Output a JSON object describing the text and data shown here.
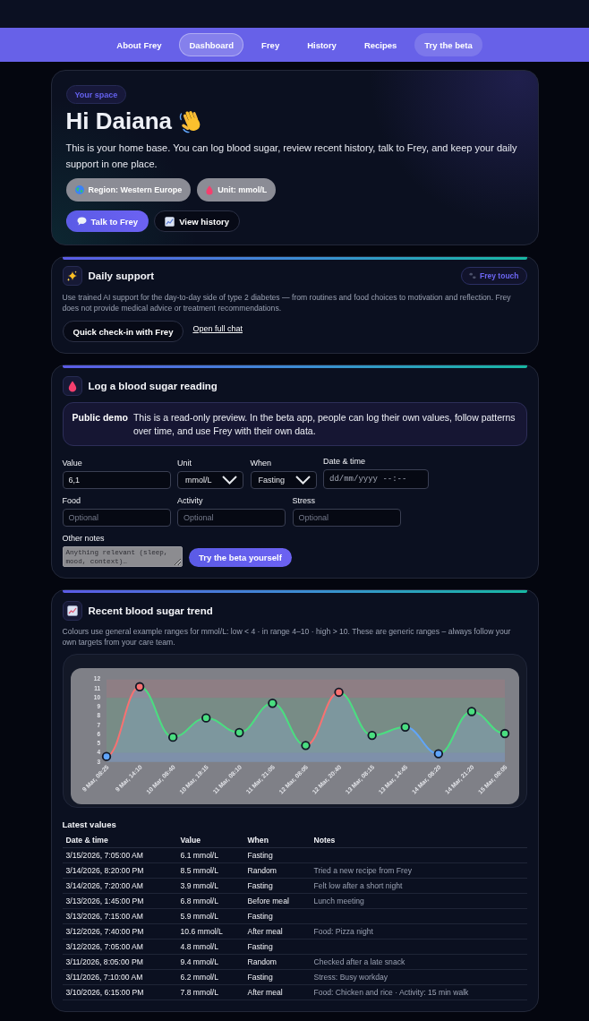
{
  "nav": {
    "items": [
      {
        "label": "About Frey",
        "selected": false,
        "kind": "link"
      },
      {
        "label": "Dashboard",
        "selected": true,
        "kind": "link"
      },
      {
        "label": "Frey",
        "selected": false,
        "kind": "link"
      },
      {
        "label": "History",
        "selected": false,
        "kind": "link"
      },
      {
        "label": "Recipes",
        "selected": false,
        "kind": "link"
      },
      {
        "label": "Try the beta",
        "selected": false,
        "kind": "cta"
      }
    ]
  },
  "hero": {
    "badge": "Your space",
    "title": "Hi Daiana",
    "text": "This is your home base. You can log blood sugar, review recent history, talk to Frey, and keep your daily support in one place.",
    "chips": [
      {
        "kind": "region",
        "label": "Region: Western Europe"
      },
      {
        "kind": "unit",
        "label": "Unit: mmol/L"
      }
    ],
    "actions": [
      {
        "kind": "primary",
        "label": "Talk to Frey"
      },
      {
        "kind": "secondary",
        "label": "View history"
      }
    ]
  },
  "daily_support": {
    "title": "Daily support",
    "badge": "Frey touch",
    "text": "Use trained AI support for the day-to-day side of type 2 diabetes — from routines and food choices to motivation and reflection. Frey does not provide medical advice or treatment recommendations.",
    "button": "Quick check-in with Frey",
    "link": "Open full chat"
  },
  "log_reading": {
    "title": "Log a blood sugar reading",
    "notice": {
      "label": "Public demo",
      "text": "This is a read-only preview. In the beta app, people can log their own values, follow patterns over time, and use Frey with their own data."
    },
    "field_rows": [
      {
        "fields": [
          {
            "kind": "input",
            "label": "Value",
            "value": "6,1"
          },
          {
            "kind": "select",
            "label": "Unit",
            "value": "mmol/L"
          },
          {
            "kind": "select",
            "label": "When",
            "value": "Fasting"
          },
          {
            "kind": "datetime",
            "label": "Date & time",
            "placeholder": "dd/mm/yyyy --:--"
          }
        ]
      },
      {
        "fields": [
          {
            "kind": "input",
            "label": "Food",
            "placeholder": "Optional"
          },
          {
            "kind": "input",
            "label": "Activity",
            "placeholder": "Optional"
          },
          {
            "kind": "input",
            "label": "Stress",
            "placeholder": "Optional"
          }
        ]
      }
    ],
    "notes": {
      "label": "Other notes",
      "placeholder": "Anything relevant (sleep, mood, context)…",
      "disabled": true
    },
    "button": "Try the beta yourself"
  },
  "trend": {
    "title": "Recent blood sugar trend",
    "text": "Colours use general example ranges for mmol/L: low < 4 · in range 4–10 · high > 10. These are generic ranges – always follow your own targets from your care team.",
    "chart_data": {
      "type": "area",
      "marker": true,
      "categories": [
        "9 Mar, 08:25",
        "9 Mar, 14:10",
        "10 Mar, 08:40",
        "10 Mar, 19:15",
        "11 Mar, 08:10",
        "11 Mar, 21:05",
        "12 Mar, 08:05",
        "12 Mar, 20:40",
        "13 Mar, 08:15",
        "13 Mar, 14:45",
        "14 Mar, 08:20",
        "14 Mar, 21:20",
        "15 Mar, 08:05"
      ],
      "values": [
        3.6,
        11.2,
        5.7,
        7.8,
        6.2,
        9.4,
        4.8,
        10.6,
        5.9,
        6.8,
        3.9,
        8.5,
        6.1
      ],
      "ylim": [
        3,
        12
      ],
      "yticks": [
        3,
        4,
        5,
        6,
        7,
        8,
        9,
        10,
        11,
        12
      ],
      "bands": [
        {
          "axis": "y",
          "from": 3,
          "to": 4,
          "color": "#60a5fa"
        },
        {
          "axis": "y",
          "from": 4,
          "to": 10,
          "color": "#4ade80"
        },
        {
          "axis": "y",
          "from": 10,
          "to": 12,
          "color": "#f87171"
        }
      ]
    },
    "table": {
      "title": "Latest values",
      "columns": [
        "Date & time",
        "Value",
        "When",
        "Notes"
      ],
      "rows": [
        {
          "date": "3/15/2026, 7:05:00 AM",
          "value": "6.1 mmol/L",
          "when": "Fasting"
        },
        {
          "date": "3/14/2026, 8:20:00 PM",
          "value": "8.5 mmol/L",
          "when": "Random",
          "notes": "Tried a new recipe from Frey"
        },
        {
          "date": "3/14/2026, 7:20:00 AM",
          "value": "3.9 mmol/L",
          "when": "Fasting",
          "notes": "Felt low after a short night"
        },
        {
          "date": "3/13/2026, 1:45:00 PM",
          "value": "6.8 mmol/L",
          "when": "Before meal",
          "notes": "Lunch meeting"
        },
        {
          "date": "3/13/2026, 7:15:00 AM",
          "value": "5.9 mmol/L",
          "when": "Fasting"
        },
        {
          "date": "3/12/2026, 7:40:00 PM",
          "value": "10.6 mmol/L",
          "when": "After meal",
          "notes": "Food: Pizza night"
        },
        {
          "date": "3/12/2026, 7:05:00 AM",
          "value": "4.8 mmol/L",
          "when": "Fasting"
        },
        {
          "date": "3/11/2026, 8:05:00 PM",
          "value": "9.4 mmol/L",
          "when": "Random",
          "notes": "Checked after a late snack"
        },
        {
          "date": "3/11/2026, 7:10:00 AM",
          "value": "6.2 mmol/L",
          "when": "Fasting",
          "notes": "Stress: Busy workday"
        },
        {
          "date": "3/10/2026, 6:15:00 PM",
          "value": "7.8 mmol/L",
          "when": "After meal",
          "notes": "Food: Chicken and rice · Activity: 15 min walk"
        }
      ]
    }
  }
}
